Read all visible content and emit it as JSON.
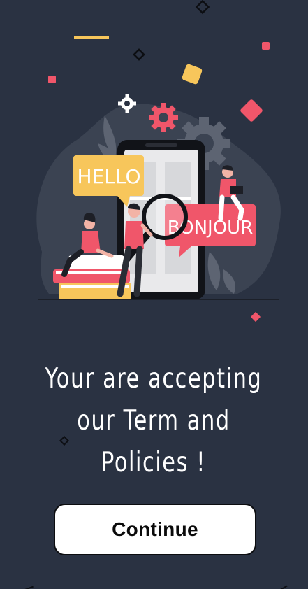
{
  "illustration": {
    "bubble_hello": "HELLO",
    "bubble_bonjour": "BONJOUR"
  },
  "headline": {
    "line1": "Your are accepting",
    "line2": "our Term and",
    "line3": "Policies !"
  },
  "continue_button": {
    "label": "Continue"
  },
  "colors": {
    "background": "#2a3242",
    "accent_pink": "#f0566a",
    "accent_yellow": "#f7c65b",
    "button_bg": "#ffffff"
  }
}
